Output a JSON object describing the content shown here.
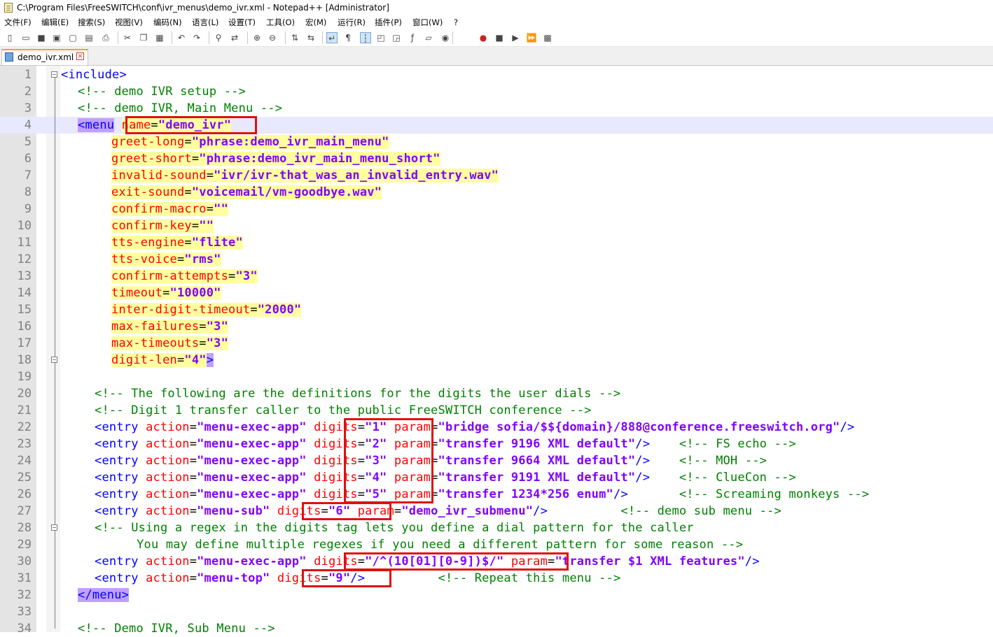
{
  "window": {
    "title": "C:\\Program Files\\FreeSWITCH\\conf\\ivr_menus\\demo_ivr.xml - Notepad++ [Administrator]"
  },
  "menu": [
    "文件(F)",
    "编辑(E)",
    "搜索(S)",
    "视图(V)",
    "编码(N)",
    "语言(L)",
    "设置(T)",
    "工具(O)",
    "宏(M)",
    "运行(R)",
    "插件(P)",
    "窗口(W)",
    "?"
  ],
  "toolbar": {
    "icons": [
      "new-icon",
      "open-icon",
      "save-icon",
      "save-all-icon",
      "close-icon",
      "close-all-icon",
      "print-icon",
      "cut-icon",
      "copy-icon",
      "paste-icon",
      "undo-icon",
      "redo-icon",
      "find-icon",
      "replace-icon",
      "zoom-in-icon",
      "zoom-out-icon",
      "sync-vertical-icon",
      "sync-horizontal-icon",
      "word-wrap-icon",
      "show-all-chars-icon",
      "indent-guide-icon",
      "user-lang-icon",
      "doc-map-icon",
      "function-list-icon",
      "folder-workspace-icon",
      "monitor-icon",
      "macro-record-icon",
      "macro-stop-icon",
      "macro-play-icon",
      "macro-run-multiple-icon",
      "macro-save-icon"
    ]
  },
  "tab": {
    "name": "demo_ivr.xml"
  },
  "editor": {
    "current_line": 4,
    "lines": [
      {
        "n": "1",
        "indent": 0,
        "parts": [
          [
            "tg",
            "<include>"
          ]
        ]
      },
      {
        "n": "2",
        "indent": 2,
        "parts": [
          [
            "cm",
            "<!-- demo IVR setup -->"
          ]
        ]
      },
      {
        "n": "3",
        "indent": 2,
        "parts": [
          [
            "cm",
            "<!-- demo IVR, Main Menu -->"
          ]
        ]
      },
      {
        "n": "4",
        "indent": 2,
        "parts": [
          [
            "tgm",
            "<"
          ],
          [
            "tgm",
            "menu"
          ],
          [
            "tg",
            " "
          ],
          [
            "at",
            "name"
          ],
          [
            "eq",
            "="
          ],
          [
            "vl",
            "\"demo_ivr\""
          ]
        ]
      },
      {
        "n": "5",
        "indent": 6,
        "parts": [
          [
            "at",
            "greet-long"
          ],
          [
            "eq",
            "="
          ],
          [
            "vl",
            "\"phrase:demo_ivr_main_menu\""
          ]
        ]
      },
      {
        "n": "6",
        "indent": 6,
        "parts": [
          [
            "at",
            "greet-short"
          ],
          [
            "eq",
            "="
          ],
          [
            "vl",
            "\"phrase:demo_ivr_main_menu_short\""
          ]
        ]
      },
      {
        "n": "7",
        "indent": 6,
        "parts": [
          [
            "at",
            "invalid-sound"
          ],
          [
            "eq",
            "="
          ],
          [
            "vl",
            "\"ivr/ivr-that_was_an_invalid_entry.wav\""
          ]
        ]
      },
      {
        "n": "8",
        "indent": 6,
        "parts": [
          [
            "at",
            "exit-sound"
          ],
          [
            "eq",
            "="
          ],
          [
            "vl",
            "\"voicemail/vm-goodbye.wav\""
          ]
        ]
      },
      {
        "n": "9",
        "indent": 6,
        "parts": [
          [
            "at",
            "confirm-macro"
          ],
          [
            "eq",
            "="
          ],
          [
            "vl",
            "\"\""
          ]
        ]
      },
      {
        "n": "10",
        "indent": 6,
        "parts": [
          [
            "at",
            "confirm-key"
          ],
          [
            "eq",
            "="
          ],
          [
            "vl",
            "\"\""
          ]
        ]
      },
      {
        "n": "11",
        "indent": 6,
        "parts": [
          [
            "at",
            "tts-engine"
          ],
          [
            "eq",
            "="
          ],
          [
            "vl",
            "\"flite\""
          ]
        ]
      },
      {
        "n": "12",
        "indent": 6,
        "parts": [
          [
            "at",
            "tts-voice"
          ],
          [
            "eq",
            "="
          ],
          [
            "vl",
            "\"rms\""
          ]
        ]
      },
      {
        "n": "13",
        "indent": 6,
        "parts": [
          [
            "at",
            "confirm-attempts"
          ],
          [
            "eq",
            "="
          ],
          [
            "vl",
            "\"3\""
          ]
        ]
      },
      {
        "n": "14",
        "indent": 6,
        "parts": [
          [
            "at",
            "timeout"
          ],
          [
            "eq",
            "="
          ],
          [
            "vl",
            "\"10000\""
          ]
        ]
      },
      {
        "n": "15",
        "indent": 6,
        "parts": [
          [
            "at",
            "inter-digit-timeout"
          ],
          [
            "eq",
            "="
          ],
          [
            "vl",
            "\"2000\""
          ]
        ]
      },
      {
        "n": "16",
        "indent": 6,
        "parts": [
          [
            "at",
            "max-failures"
          ],
          [
            "eq",
            "="
          ],
          [
            "vl",
            "\"3\""
          ]
        ]
      },
      {
        "n": "17",
        "indent": 6,
        "parts": [
          [
            "at",
            "max-timeouts"
          ],
          [
            "eq",
            "="
          ],
          [
            "vl",
            "\"3\""
          ]
        ]
      },
      {
        "n": "18",
        "indent": 6,
        "parts": [
          [
            "at",
            "digit-len"
          ],
          [
            "eq",
            "="
          ],
          [
            "vl",
            "\"4\""
          ],
          [
            "tgm",
            ">"
          ]
        ]
      },
      {
        "n": "19",
        "indent": 0,
        "parts": []
      },
      {
        "n": "20",
        "indent": 4,
        "parts": [
          [
            "cm",
            "<!-- The following are the definitions for the digits the user dials -->"
          ]
        ]
      },
      {
        "n": "21",
        "indent": 4,
        "parts": [
          [
            "cm",
            "<!-- Digit 1 transfer caller to the public FreeSWITCH conference -->"
          ]
        ]
      },
      {
        "n": "22",
        "indent": 4,
        "parts": [
          [
            "tg",
            "<entry "
          ],
          [
            "at",
            "action"
          ],
          [
            "eq",
            "="
          ],
          [
            "vl",
            "\"menu-exec-app\""
          ],
          [
            "tg",
            " "
          ],
          [
            "at",
            "digits"
          ],
          [
            "eq",
            "="
          ],
          [
            "vl",
            "\"1\""
          ],
          [
            "tg",
            " "
          ],
          [
            "at",
            "param"
          ],
          [
            "eq",
            "="
          ],
          [
            "vl",
            "\"bridge sofia/$${domain}/888@conference.freeswitch.org\""
          ],
          [
            "tg",
            "/>"
          ]
        ]
      },
      {
        "n": "23",
        "indent": 4,
        "parts": [
          [
            "tg",
            "<entry "
          ],
          [
            "at",
            "action"
          ],
          [
            "eq",
            "="
          ],
          [
            "vl",
            "\"menu-exec-app\""
          ],
          [
            "tg",
            " "
          ],
          [
            "at",
            "digits"
          ],
          [
            "eq",
            "="
          ],
          [
            "vl",
            "\"2\""
          ],
          [
            "tg",
            " "
          ],
          [
            "at",
            "param"
          ],
          [
            "eq",
            "="
          ],
          [
            "vl",
            "\"transfer 9196 XML default\""
          ],
          [
            "tg",
            "/>"
          ],
          [
            "tg",
            "    "
          ],
          [
            "cm",
            "<!-- FS echo -->"
          ]
        ]
      },
      {
        "n": "24",
        "indent": 4,
        "parts": [
          [
            "tg",
            "<entry "
          ],
          [
            "at",
            "action"
          ],
          [
            "eq",
            "="
          ],
          [
            "vl",
            "\"menu-exec-app\""
          ],
          [
            "tg",
            " "
          ],
          [
            "at",
            "digits"
          ],
          [
            "eq",
            "="
          ],
          [
            "vl",
            "\"3\""
          ],
          [
            "tg",
            " "
          ],
          [
            "at",
            "param"
          ],
          [
            "eq",
            "="
          ],
          [
            "vl",
            "\"transfer 9664 XML default\""
          ],
          [
            "tg",
            "/>"
          ],
          [
            "tg",
            "    "
          ],
          [
            "cm",
            "<!-- MOH -->"
          ]
        ]
      },
      {
        "n": "25",
        "indent": 4,
        "parts": [
          [
            "tg",
            "<entry "
          ],
          [
            "at",
            "action"
          ],
          [
            "eq",
            "="
          ],
          [
            "vl",
            "\"menu-exec-app\""
          ],
          [
            "tg",
            " "
          ],
          [
            "at",
            "digits"
          ],
          [
            "eq",
            "="
          ],
          [
            "vl",
            "\"4\""
          ],
          [
            "tg",
            " "
          ],
          [
            "at",
            "param"
          ],
          [
            "eq",
            "="
          ],
          [
            "vl",
            "\"transfer 9191 XML default\""
          ],
          [
            "tg",
            "/>"
          ],
          [
            "tg",
            "    "
          ],
          [
            "cm",
            "<!-- ClueCon -->"
          ]
        ]
      },
      {
        "n": "26",
        "indent": 4,
        "parts": [
          [
            "tg",
            "<entry "
          ],
          [
            "at",
            "action"
          ],
          [
            "eq",
            "="
          ],
          [
            "vl",
            "\"menu-exec-app\""
          ],
          [
            "tg",
            " "
          ],
          [
            "at",
            "digits"
          ],
          [
            "eq",
            "="
          ],
          [
            "vl",
            "\"5\""
          ],
          [
            "tg",
            " "
          ],
          [
            "at",
            "param"
          ],
          [
            "eq",
            "="
          ],
          [
            "vl",
            "\"transfer 1234*256 enum\""
          ],
          [
            "tg",
            "/>"
          ],
          [
            "tg",
            "       "
          ],
          [
            "cm",
            "<!-- Screaming monkeys -->"
          ]
        ]
      },
      {
        "n": "27",
        "indent": 4,
        "parts": [
          [
            "tg",
            "<entry "
          ],
          [
            "at",
            "action"
          ],
          [
            "eq",
            "="
          ],
          [
            "vl",
            "\"menu-sub\""
          ],
          [
            "tg",
            " "
          ],
          [
            "at",
            "digits"
          ],
          [
            "eq",
            "="
          ],
          [
            "vl",
            "\"6\""
          ],
          [
            "tg",
            " "
          ],
          [
            "at",
            "param"
          ],
          [
            "eq",
            "="
          ],
          [
            "vl",
            "\"demo_ivr_submenu\""
          ],
          [
            "tg",
            "/>"
          ],
          [
            "tg",
            "          "
          ],
          [
            "cm",
            "<!-- demo sub menu -->"
          ]
        ]
      },
      {
        "n": "28",
        "indent": 4,
        "parts": [
          [
            "cm",
            "<!-- Using a regex in the digits tag lets you define a dial pattern for the caller"
          ]
        ]
      },
      {
        "n": "29",
        "indent": 9,
        "parts": [
          [
            "cm",
            "You may define multiple regexes if you need a different pattern for some reason -->"
          ]
        ]
      },
      {
        "n": "30",
        "indent": 4,
        "parts": [
          [
            "tg",
            "<entry "
          ],
          [
            "at",
            "action"
          ],
          [
            "eq",
            "="
          ],
          [
            "vl",
            "\"menu-exec-app\""
          ],
          [
            "tg",
            " "
          ],
          [
            "at",
            "digits"
          ],
          [
            "eq",
            "="
          ],
          [
            "vl",
            "\"/^(10[01][0-9])$/\""
          ],
          [
            "tg",
            " "
          ],
          [
            "at",
            "param"
          ],
          [
            "eq",
            "="
          ],
          [
            "vl",
            "\"transfer $1 XML features\""
          ],
          [
            "tg",
            "/>"
          ]
        ]
      },
      {
        "n": "31",
        "indent": 4,
        "parts": [
          [
            "tg",
            "<entry "
          ],
          [
            "at",
            "action"
          ],
          [
            "eq",
            "="
          ],
          [
            "vl",
            "\"menu-top\""
          ],
          [
            "tg",
            " "
          ],
          [
            "at",
            "digits"
          ],
          [
            "eq",
            "="
          ],
          [
            "vl",
            "\"9\""
          ],
          [
            "tg",
            "/>"
          ],
          [
            "tg",
            "          "
          ],
          [
            "cm",
            "<!-- Repeat this menu -->"
          ]
        ]
      },
      {
        "n": "32",
        "indent": 2,
        "parts": [
          [
            "tgm",
            "</menu"
          ],
          [
            "tgm",
            ">"
          ]
        ]
      },
      {
        "n": "33",
        "indent": 0,
        "parts": []
      },
      {
        "n": "34",
        "indent": 2,
        "parts": [
          [
            "cm",
            "<!-- Demo IVR, Sub Menu -->"
          ]
        ]
      }
    ]
  }
}
